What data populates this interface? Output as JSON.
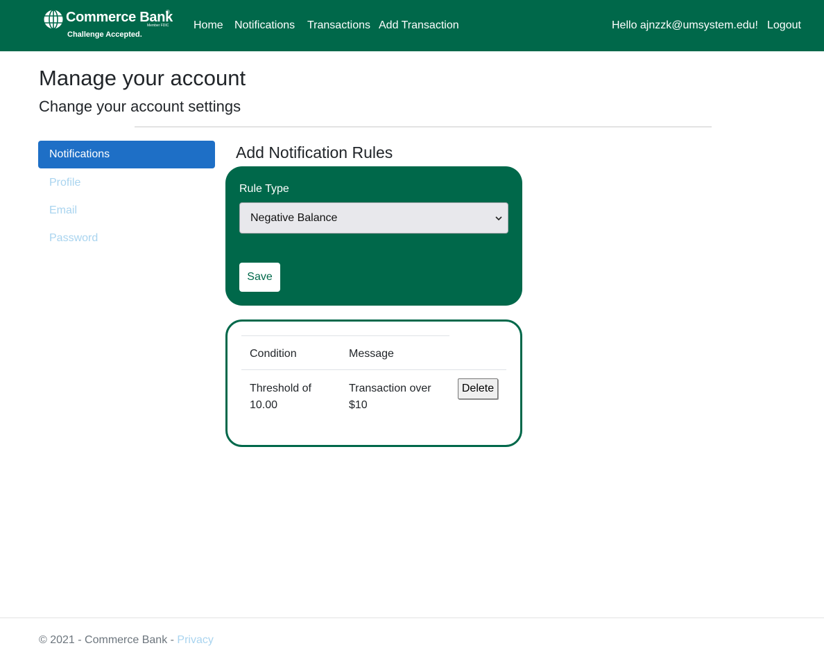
{
  "brand": {
    "name": "Commerce Bank",
    "registered": "®",
    "fdic": "Member FDIC",
    "tagline": "Challenge Accepted."
  },
  "nav": {
    "links": [
      "Home",
      "Notifications",
      "Transactions",
      "Add Transaction"
    ],
    "greeting": "Hello ajnzzk@umsystem.edu!",
    "logout": "Logout"
  },
  "page": {
    "title": "Manage your account",
    "subtitle": "Change your account settings"
  },
  "sidebar": {
    "items": [
      {
        "label": "Notifications",
        "active": true
      },
      {
        "label": "Profile",
        "active": false
      },
      {
        "label": "Email",
        "active": false
      },
      {
        "label": "Password",
        "active": false
      }
    ]
  },
  "form": {
    "heading": "Add Notification Rules",
    "rule_type_label": "Rule Type",
    "rule_type_value": "Negative Balance",
    "save_label": "Save"
  },
  "rules_table": {
    "headers": [
      "Condition",
      "Message"
    ],
    "rows": [
      {
        "condition": "Threshold of 10.00",
        "message": "Transaction over $10",
        "action": "Delete"
      }
    ]
  },
  "footer": {
    "text": "© 2021 - Commerce Bank - ",
    "privacy": "Privacy"
  },
  "colors": {
    "brand_green": "#00684a",
    "active_blue": "#1e6fc6",
    "link_muted": "#a9d4ef"
  }
}
